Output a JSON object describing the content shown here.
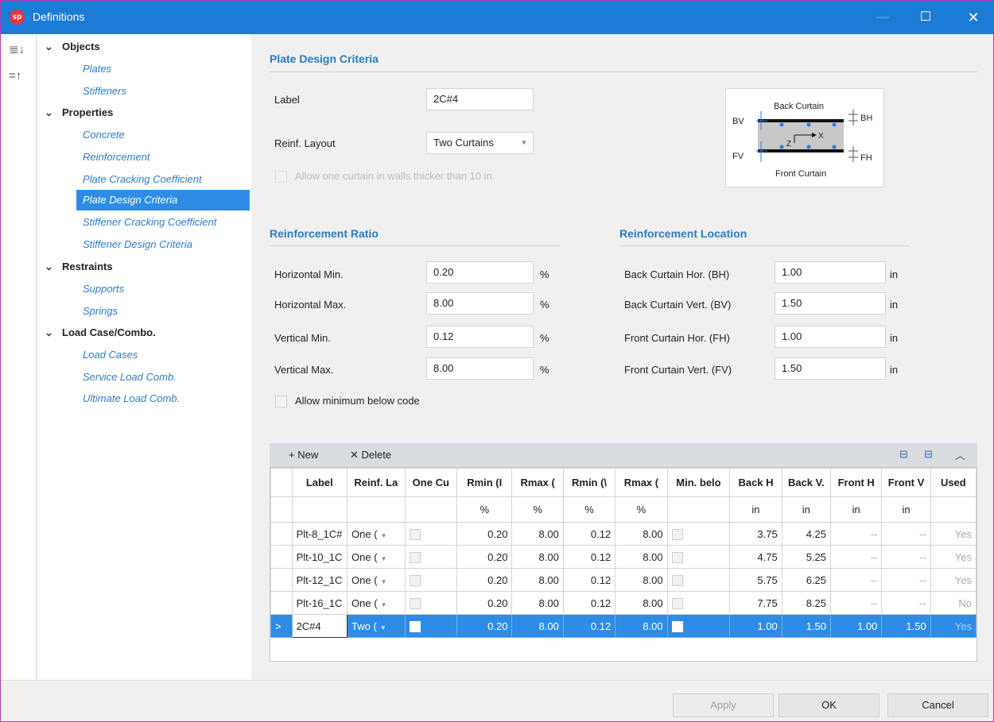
{
  "window": {
    "logo": "sp",
    "title": "Definitions"
  },
  "tree": {
    "groups": [
      {
        "label": "Objects",
        "items": [
          "Plates",
          "Stiffeners"
        ]
      },
      {
        "label": "Properties",
        "items": [
          "Concrete",
          "Reinforcement",
          "Plate Cracking Coefficient",
          "Plate Design Criteria",
          "Stiffener Cracking Coefficient",
          "Stiffener Design Criteria"
        ]
      },
      {
        "label": "Restraints",
        "items": [
          "Supports",
          "Springs"
        ]
      },
      {
        "label": "Load Case/Combo.",
        "items": [
          "Load Cases",
          "Service Load Comb.",
          "Ultimate Load Comb."
        ]
      }
    ],
    "selected": "Plate Design Criteria"
  },
  "criteria": {
    "title": "Plate Design Criteria",
    "label_caption": "Label",
    "label_value": "2C#4",
    "layout_caption": "Reinf. Layout",
    "layout_value": "Two Curtains",
    "one_curtain_caption": "Allow one curtain in walls thicker than 10 in."
  },
  "diagram": {
    "back_curtain": "Back Curtain",
    "front_curtain": "Front Curtain",
    "bv": "BV",
    "fv": "FV",
    "bh": "BH",
    "fh": "FH",
    "z": "Z",
    "x": "X"
  },
  "ratio": {
    "title": "Reinforcement Ratio",
    "rows": [
      {
        "label": "Horizontal Min.",
        "value": "0.20",
        "unit": "%"
      },
      {
        "label": "Horizontal Max.",
        "value": "8.00",
        "unit": "%"
      },
      {
        "label": "Vertical Min.",
        "value": "0.12",
        "unit": "%"
      },
      {
        "label": "Vertical Max.",
        "value": "8.00",
        "unit": "%"
      }
    ],
    "allow_min_caption": "Allow minimum below code"
  },
  "location": {
    "title": "Reinforcement Location",
    "rows": [
      {
        "label": "Back Curtain Hor. (BH)",
        "value": "1.00",
        "unit": "in"
      },
      {
        "label": "Back Curtain Vert. (BV)",
        "value": "1.50",
        "unit": "in"
      },
      {
        "label": "Front Curtain Hor. (FH)",
        "value": "1.00",
        "unit": "in"
      },
      {
        "label": "Front Curtain Vert. (FV)",
        "value": "1.50",
        "unit": "in"
      }
    ]
  },
  "grid": {
    "new_label": "New",
    "delete_label": "Delete",
    "headers": [
      "Label",
      "Reinf. La",
      "One Cu",
      "Rmin (I",
      "Rmax (",
      "Rmin (\\",
      "Rmax (",
      "Min. belo",
      "Back H",
      "Back V.",
      "Front H",
      "Front V",
      "Used"
    ],
    "units": [
      "",
      "",
      "",
      "%",
      "%",
      "%",
      "%",
      "",
      "in",
      "in",
      "in",
      "in",
      ""
    ],
    "rows": [
      {
        "label": "Plt-8_1C#",
        "layout": "One (",
        "rmin_h": "0.20",
        "rmax_h": "8.00",
        "rmin_v": "0.12",
        "rmax_v": "8.00",
        "bh": "3.75",
        "bv": "4.25",
        "fh": "--",
        "fv": "--",
        "used": "Yes"
      },
      {
        "label": "Plt-10_1C",
        "layout": "One (",
        "rmin_h": "0.20",
        "rmax_h": "8.00",
        "rmin_v": "0.12",
        "rmax_v": "8.00",
        "bh": "4.75",
        "bv": "5.25",
        "fh": "--",
        "fv": "--",
        "used": "Yes"
      },
      {
        "label": "Plt-12_1C",
        "layout": "One (",
        "rmin_h": "0.20",
        "rmax_h": "8.00",
        "rmin_v": "0.12",
        "rmax_v": "8.00",
        "bh": "5.75",
        "bv": "6.25",
        "fh": "--",
        "fv": "--",
        "used": "Yes"
      },
      {
        "label": "Plt-16_1C",
        "layout": "One (",
        "rmin_h": "0.20",
        "rmax_h": "8.00",
        "rmin_v": "0.12",
        "rmax_v": "8.00",
        "bh": "7.75",
        "bv": "8.25",
        "fh": "--",
        "fv": "--",
        "used": "No"
      },
      {
        "label": "2C#4",
        "layout": "Two (",
        "rmin_h": "0.20",
        "rmax_h": "8.00",
        "rmin_v": "0.12",
        "rmax_v": "8.00",
        "bh": "1.00",
        "bv": "1.50",
        "fh": "1.00",
        "fv": "1.50",
        "used": "Yes"
      }
    ]
  },
  "footer": {
    "apply": "Apply",
    "ok": "OK",
    "cancel": "Cancel"
  },
  "colors": {
    "accent": "#2e8ce6",
    "titlebar": "#1c7bd6",
    "section": "#2a7cc6",
    "tree_link": "#2d7bc9"
  }
}
